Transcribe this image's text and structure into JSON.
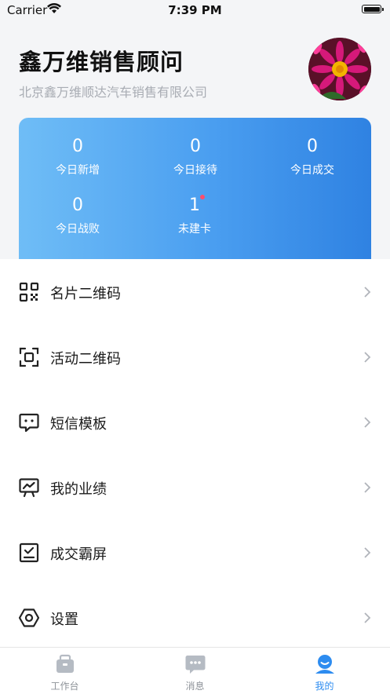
{
  "status_bar": {
    "carrier": "Carrier",
    "time": "7:39 PM"
  },
  "profile": {
    "name": "鑫万维销售顾问",
    "company": "北京鑫万维顺达汽车销售有限公司"
  },
  "stats": [
    {
      "value": "0",
      "label": "今日新增"
    },
    {
      "value": "0",
      "label": "今日接待"
    },
    {
      "value": "0",
      "label": "今日成交"
    },
    {
      "value": "0",
      "label": "今日战败"
    },
    {
      "value": "1",
      "label": "未建卡",
      "badge": true
    }
  ],
  "menu": [
    {
      "label": "名片二维码",
      "icon": "qr-code-icon"
    },
    {
      "label": "活动二维码",
      "icon": "scan-frame-icon"
    },
    {
      "label": "短信模板",
      "icon": "message-box-icon"
    },
    {
      "label": "我的业绩",
      "icon": "performance-chart-icon"
    },
    {
      "label": "成交霸屏",
      "icon": "deal-screen-icon"
    },
    {
      "label": "设置",
      "icon": "hexagon-settings-icon"
    }
  ],
  "tabs": [
    {
      "label": "工作台",
      "icon": "workbench-icon",
      "active": false
    },
    {
      "label": "消息",
      "icon": "message-icon",
      "active": false
    },
    {
      "label": "我的",
      "icon": "profile-icon",
      "active": true
    }
  ],
  "colors": {
    "accent": "#2d8cf0",
    "card_start": "#6fbdf6",
    "card_end": "#2f82e2",
    "badge": "#ff4d6d"
  }
}
